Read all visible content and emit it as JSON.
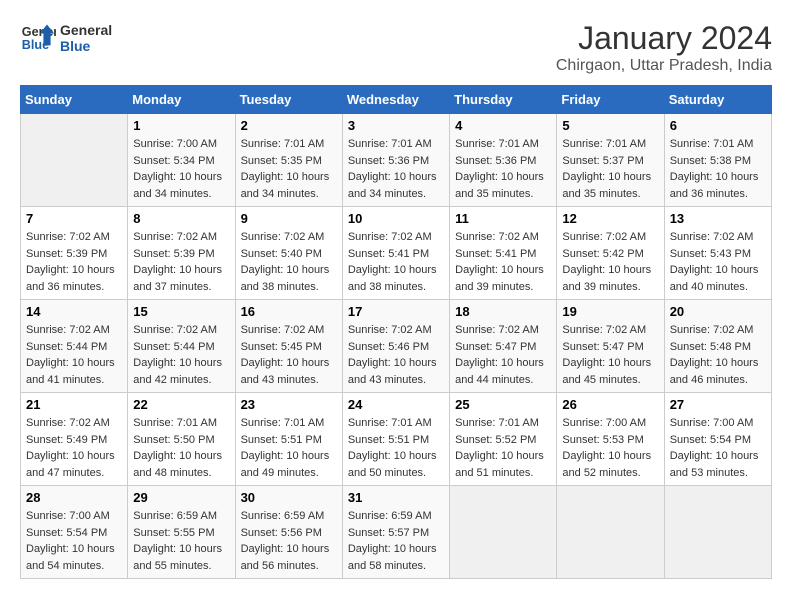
{
  "logo": {
    "line1": "General",
    "line2": "Blue"
  },
  "title": "January 2024",
  "subtitle": "Chirgaon, Uttar Pradesh, India",
  "days_header": [
    "Sunday",
    "Monday",
    "Tuesday",
    "Wednesday",
    "Thursday",
    "Friday",
    "Saturday"
  ],
  "weeks": [
    [
      {
        "day": "",
        "info": ""
      },
      {
        "day": "1",
        "info": "Sunrise: 7:00 AM\nSunset: 5:34 PM\nDaylight: 10 hours\nand 34 minutes."
      },
      {
        "day": "2",
        "info": "Sunrise: 7:01 AM\nSunset: 5:35 PM\nDaylight: 10 hours\nand 34 minutes."
      },
      {
        "day": "3",
        "info": "Sunrise: 7:01 AM\nSunset: 5:36 PM\nDaylight: 10 hours\nand 34 minutes."
      },
      {
        "day": "4",
        "info": "Sunrise: 7:01 AM\nSunset: 5:36 PM\nDaylight: 10 hours\nand 35 minutes."
      },
      {
        "day": "5",
        "info": "Sunrise: 7:01 AM\nSunset: 5:37 PM\nDaylight: 10 hours\nand 35 minutes."
      },
      {
        "day": "6",
        "info": "Sunrise: 7:01 AM\nSunset: 5:38 PM\nDaylight: 10 hours\nand 36 minutes."
      }
    ],
    [
      {
        "day": "7",
        "info": "Sunrise: 7:02 AM\nSunset: 5:39 PM\nDaylight: 10 hours\nand 36 minutes."
      },
      {
        "day": "8",
        "info": "Sunrise: 7:02 AM\nSunset: 5:39 PM\nDaylight: 10 hours\nand 37 minutes."
      },
      {
        "day": "9",
        "info": "Sunrise: 7:02 AM\nSunset: 5:40 PM\nDaylight: 10 hours\nand 38 minutes."
      },
      {
        "day": "10",
        "info": "Sunrise: 7:02 AM\nSunset: 5:41 PM\nDaylight: 10 hours\nand 38 minutes."
      },
      {
        "day": "11",
        "info": "Sunrise: 7:02 AM\nSunset: 5:41 PM\nDaylight: 10 hours\nand 39 minutes."
      },
      {
        "day": "12",
        "info": "Sunrise: 7:02 AM\nSunset: 5:42 PM\nDaylight: 10 hours\nand 39 minutes."
      },
      {
        "day": "13",
        "info": "Sunrise: 7:02 AM\nSunset: 5:43 PM\nDaylight: 10 hours\nand 40 minutes."
      }
    ],
    [
      {
        "day": "14",
        "info": "Sunrise: 7:02 AM\nSunset: 5:44 PM\nDaylight: 10 hours\nand 41 minutes."
      },
      {
        "day": "15",
        "info": "Sunrise: 7:02 AM\nSunset: 5:44 PM\nDaylight: 10 hours\nand 42 minutes."
      },
      {
        "day": "16",
        "info": "Sunrise: 7:02 AM\nSunset: 5:45 PM\nDaylight: 10 hours\nand 43 minutes."
      },
      {
        "day": "17",
        "info": "Sunrise: 7:02 AM\nSunset: 5:46 PM\nDaylight: 10 hours\nand 43 minutes."
      },
      {
        "day": "18",
        "info": "Sunrise: 7:02 AM\nSunset: 5:47 PM\nDaylight: 10 hours\nand 44 minutes."
      },
      {
        "day": "19",
        "info": "Sunrise: 7:02 AM\nSunset: 5:47 PM\nDaylight: 10 hours\nand 45 minutes."
      },
      {
        "day": "20",
        "info": "Sunrise: 7:02 AM\nSunset: 5:48 PM\nDaylight: 10 hours\nand 46 minutes."
      }
    ],
    [
      {
        "day": "21",
        "info": "Sunrise: 7:02 AM\nSunset: 5:49 PM\nDaylight: 10 hours\nand 47 minutes."
      },
      {
        "day": "22",
        "info": "Sunrise: 7:01 AM\nSunset: 5:50 PM\nDaylight: 10 hours\nand 48 minutes."
      },
      {
        "day": "23",
        "info": "Sunrise: 7:01 AM\nSunset: 5:51 PM\nDaylight: 10 hours\nand 49 minutes."
      },
      {
        "day": "24",
        "info": "Sunrise: 7:01 AM\nSunset: 5:51 PM\nDaylight: 10 hours\nand 50 minutes."
      },
      {
        "day": "25",
        "info": "Sunrise: 7:01 AM\nSunset: 5:52 PM\nDaylight: 10 hours\nand 51 minutes."
      },
      {
        "day": "26",
        "info": "Sunrise: 7:00 AM\nSunset: 5:53 PM\nDaylight: 10 hours\nand 52 minutes."
      },
      {
        "day": "27",
        "info": "Sunrise: 7:00 AM\nSunset: 5:54 PM\nDaylight: 10 hours\nand 53 minutes."
      }
    ],
    [
      {
        "day": "28",
        "info": "Sunrise: 7:00 AM\nSunset: 5:54 PM\nDaylight: 10 hours\nand 54 minutes."
      },
      {
        "day": "29",
        "info": "Sunrise: 6:59 AM\nSunset: 5:55 PM\nDaylight: 10 hours\nand 55 minutes."
      },
      {
        "day": "30",
        "info": "Sunrise: 6:59 AM\nSunset: 5:56 PM\nDaylight: 10 hours\nand 56 minutes."
      },
      {
        "day": "31",
        "info": "Sunrise: 6:59 AM\nSunset: 5:57 PM\nDaylight: 10 hours\nand 58 minutes."
      },
      {
        "day": "",
        "info": ""
      },
      {
        "day": "",
        "info": ""
      },
      {
        "day": "",
        "info": ""
      }
    ]
  ]
}
